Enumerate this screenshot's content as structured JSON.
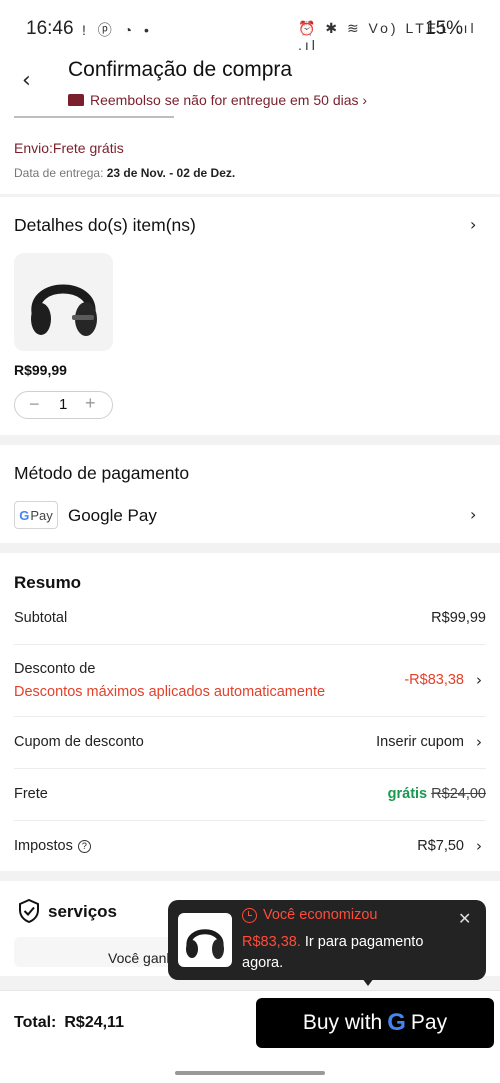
{
  "status_bar": {
    "time": "16:46",
    "left_icons": "! ⓟ ◔ •",
    "right_icons": "⏰ ✱ ≋ Vo) LTE1 .ıl .ıl",
    "battery": "15%"
  },
  "header": {
    "back_icon": "arrow-left-icon",
    "title": "Confirmação de compra",
    "refund_text": "Reembolso se não for entregue em 50 dias ›"
  },
  "shipping": {
    "method_label": "Envio:Frete grátis",
    "delivery_prefix": "Data de entrega: ",
    "delivery_range": "23 de Nov. - 02 de Dez."
  },
  "items": {
    "heading": "Detalhes do(s) item(ns)",
    "price": "R$99,99",
    "qty_minus": "−",
    "quantity": "1",
    "qty_plus": "+"
  },
  "payment": {
    "heading": "Método de pagamento",
    "logo_g": "G",
    "logo_text": "Pay",
    "method": "Google Pay"
  },
  "summary": {
    "heading": "Resumo",
    "subtotal_label": "Subtotal",
    "subtotal_value": "R$99,99",
    "discount_label": "Desconto de",
    "discount_note": "Descontos máximos aplicados automaticamente",
    "discount_value": "-R$83,38",
    "coupon_label": "Cupom de desconto",
    "coupon_value": "Inserir cupom",
    "shipping_label": "Frete",
    "shipping_free": "grátis",
    "shipping_old": "R$24,00",
    "tax_label": "Impostos",
    "tax_value": "R$7,50"
  },
  "services": {
    "heading": "serviços",
    "note": "Você ganha      00 créditos de compras"
  },
  "toast": {
    "title": "Você economizou",
    "amount": "R$83,38.",
    "message": " Ir para pagamento agora."
  },
  "footer": {
    "total_label": "Total:",
    "total_value": "R$24,11",
    "buy_prefix": "Buy with",
    "buy_g": "G",
    "buy_pay": "Pay"
  },
  "colors": {
    "accent_red": "#e4402a",
    "brand_maroon": "#7a1f2b",
    "free_green": "#1a9a51"
  }
}
